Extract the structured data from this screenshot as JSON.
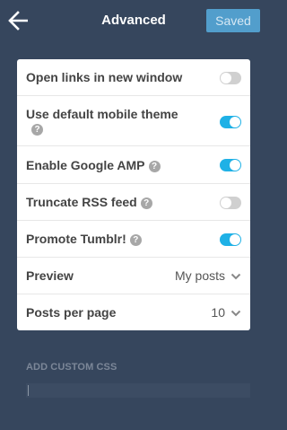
{
  "header": {
    "title": "Advanced",
    "saved_label": "Saved",
    "back_icon": "arrow-left-icon"
  },
  "settings": {
    "open_links": {
      "label": "Open links in new window",
      "enabled": false
    },
    "mobile_theme": {
      "label": "Use default mobile theme",
      "help": "?",
      "enabled": true
    },
    "google_amp": {
      "label": "Enable Google AMP",
      "help": "?",
      "enabled": true
    },
    "truncate_rss": {
      "label": "Truncate RSS feed",
      "help": "?",
      "enabled": false
    },
    "promote_tumblr": {
      "label": "Promote Tumblr!",
      "help": "?",
      "enabled": true
    },
    "preview": {
      "label": "Preview",
      "value": "My posts"
    },
    "posts_per_page": {
      "label": "Posts per page",
      "value": "10"
    }
  },
  "custom_css": {
    "label": "ADD CUSTOM CSS",
    "value": ""
  },
  "colors": {
    "background": "#36465d",
    "toggle_on": "#1fb1e6",
    "toggle_off": "#d0d0d0",
    "saved_button": "#529ecc"
  }
}
